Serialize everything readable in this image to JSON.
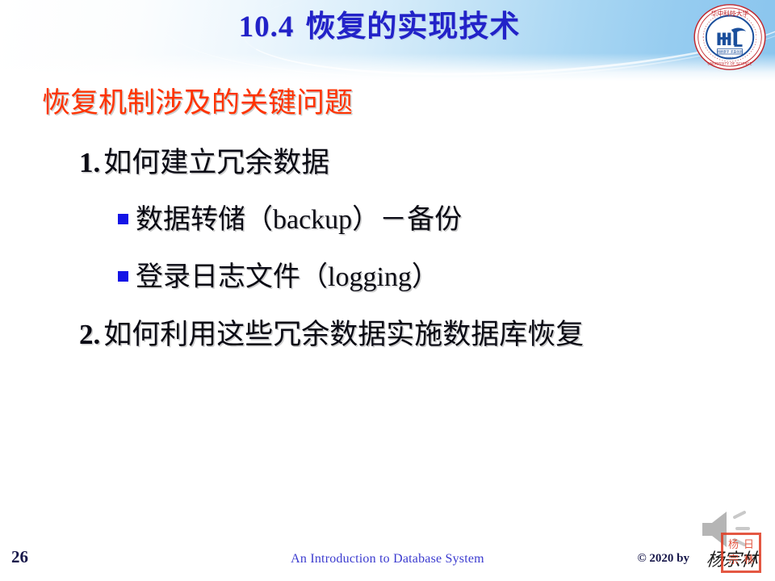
{
  "slide": {
    "title_number": "10.4",
    "title_text": "恢复的实现技术",
    "heading": "恢复机制涉及的关键问题",
    "items": [
      {
        "marker": "1.",
        "text": "如何建立冗余数据"
      },
      {
        "marker": "2.",
        "text": "如何利用这些冗余数据实施数据库恢复"
      }
    ],
    "sub_items": [
      {
        "text": "数据转储（backup）－备份"
      },
      {
        "text": "登录日志文件（logging）"
      }
    ]
  },
  "logo": {
    "name": "hust-university-emblem",
    "top_text": "华中科技大学",
    "bottom_text": "HUAZHONG UNIVERSITY OF SCIENCE AND TECHNOLOGY",
    "monogram": "HUST",
    "ring_color": "#c1272d",
    "inner_color": "#1b4f9c"
  },
  "footer": {
    "page_number": "26",
    "center_text": "An Introduction to Database System",
    "copyright": "© 2020 by",
    "signature": "杨宗林",
    "seal_chars": [
      "杨",
      "日",
      "宗",
      "林"
    ]
  },
  "colors": {
    "title": "#2222c8",
    "heading": "#ff3300",
    "body_text": "#0a0a14",
    "bullet_square": "#1414e6",
    "footer_center": "#3b3bcf",
    "page_number": "#17174a",
    "band_start": "#ffffff",
    "band_end": "#8ac5ee"
  }
}
